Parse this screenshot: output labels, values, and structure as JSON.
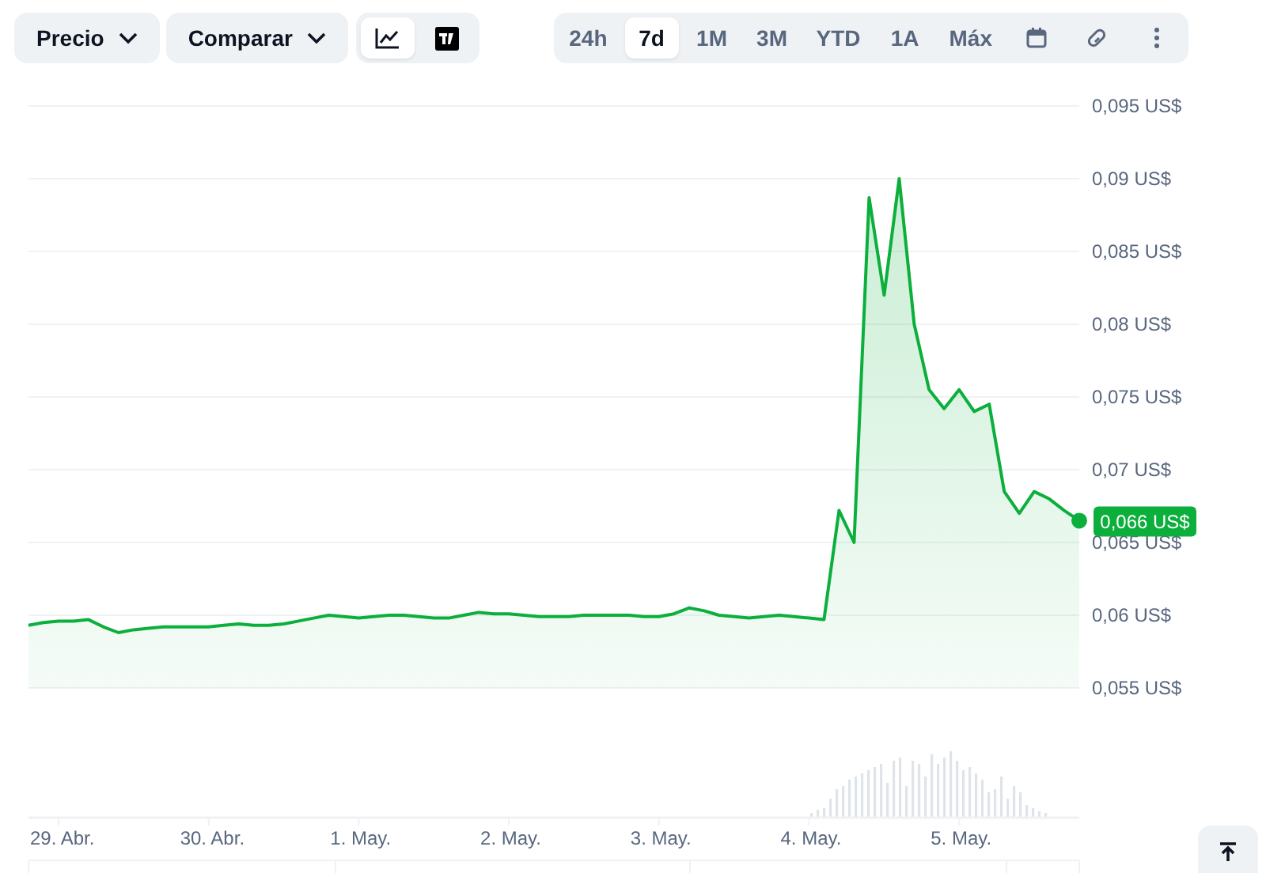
{
  "toolbar": {
    "dropdowns": [
      {
        "label": "Precio"
      },
      {
        "label": "Comparar"
      }
    ],
    "chart_types": [
      {
        "kind": "line",
        "selected": true
      },
      {
        "kind": "tradingview",
        "selected": false
      }
    ],
    "ranges": [
      {
        "label": "24h",
        "selected": false
      },
      {
        "label": "7d",
        "selected": true
      },
      {
        "label": "1M",
        "selected": false
      },
      {
        "label": "3M",
        "selected": false
      },
      {
        "label": "YTD",
        "selected": false
      },
      {
        "label": "1A",
        "selected": false
      },
      {
        "label": "Máx",
        "selected": false
      }
    ]
  },
  "chart": {
    "current_price": "0,066 US$",
    "chart_data": {
      "type": "area",
      "grid": true,
      "categories": [
        null,
        null,
        "29. Abr.",
        null,
        null,
        null,
        null,
        null,
        null,
        null,
        null,
        null,
        "30. Abr.",
        null,
        null,
        null,
        null,
        null,
        null,
        null,
        null,
        null,
        "1. May.",
        null,
        null,
        null,
        null,
        null,
        null,
        null,
        null,
        null,
        "2. May.",
        null,
        null,
        null,
        null,
        null,
        null,
        null,
        null,
        null,
        "3. May.",
        null,
        null,
        null,
        null,
        null,
        null,
        null,
        null,
        null,
        "4. May.",
        null,
        null,
        null,
        null,
        null,
        null,
        null,
        null,
        null,
        "5. May.",
        null,
        null,
        null,
        null,
        null,
        null,
        null,
        null
      ],
      "series": [
        {
          "color": "#0caf3c",
          "values": [
            0.0593,
            0.0595,
            0.0596,
            0.0596,
            0.0597,
            0.0592,
            0.0588,
            0.059,
            0.0591,
            0.0592,
            0.0592,
            0.0592,
            0.0592,
            0.0593,
            0.0594,
            0.0593,
            0.0593,
            0.0594,
            0.0596,
            0.0598,
            0.06,
            0.0599,
            0.0598,
            0.0599,
            0.06,
            0.06,
            0.0599,
            0.0598,
            0.0598,
            0.06,
            0.0602,
            0.0601,
            0.0601,
            0.06,
            0.0599,
            0.0599,
            0.0599,
            0.06,
            0.06,
            0.06,
            0.06,
            0.0599,
            0.0599,
            0.0601,
            0.0605,
            0.0603,
            0.06,
            0.0599,
            0.0598,
            0.0599,
            0.06,
            0.0599,
            0.0598,
            0.0597,
            0.0672,
            0.065,
            0.0887,
            0.082,
            0.09,
            0.08,
            0.0755,
            0.0742,
            0.0755,
            0.074,
            0.0745,
            0.0685,
            0.067,
            0.0685,
            0.068,
            0.0672,
            0.0665
          ]
        }
      ],
      "ylim": [
        0.055,
        0.095
      ],
      "yticks": [
        {
          "value": 0.055,
          "label": "0,055 US$"
        },
        {
          "value": 0.06,
          "label": "0,06 US$"
        },
        {
          "value": 0.065,
          "label": "0,065 US$"
        },
        {
          "value": 0.07,
          "label": "0,07 US$"
        },
        {
          "value": 0.075,
          "label": "0,075 US$"
        },
        {
          "value": 0.08,
          "label": "0,08 US$"
        },
        {
          "value": 0.085,
          "label": "0,085 US$"
        },
        {
          "value": 0.09,
          "label": "0,09 US$"
        },
        {
          "value": 0.095,
          "label": "0,095 US$"
        }
      ]
    }
  }
}
